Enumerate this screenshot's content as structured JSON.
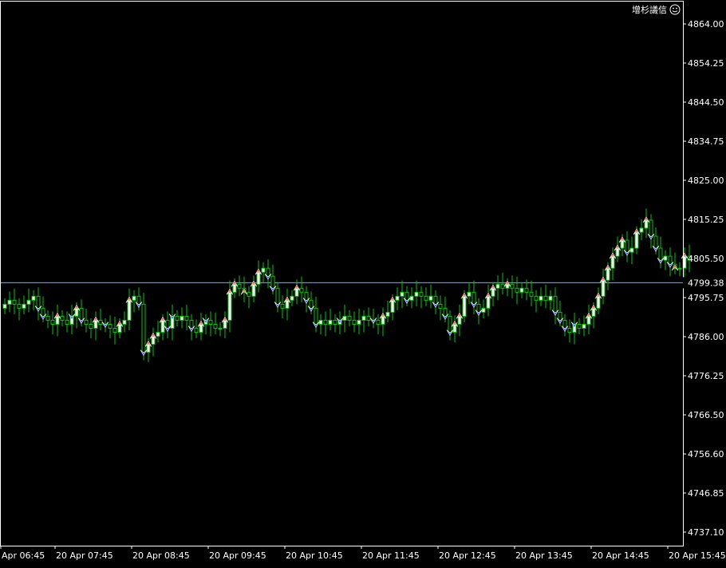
{
  "ea": {
    "name": "增杉議信",
    "smiley": "☺"
  },
  "colors": {
    "background": "#000000",
    "axis": "#ffffff",
    "bull": "#00c800",
    "bull_body": "#ffffff",
    "bear": "#00c800",
    "bear_body": "#000000",
    "price_line": "#8faac2",
    "buy_marker": "#1e3cff",
    "sell_marker": "#ff2020"
  },
  "current_price": "4799.38",
  "y_ticks": [
    "4864.00",
    "4854.25",
    "4844.50",
    "4834.75",
    "4825.00",
    "4815.25",
    "4805.50",
    "4795.75",
    "4786.00",
    "4776.25",
    "4766.50",
    "4756.60",
    "4746.85",
    "4737.10"
  ],
  "x_ticks": [
    "Apr 06:45",
    "20 Apr 07:45",
    "20 Apr 08:45",
    "20 Apr 09:45",
    "20 Apr 10:45",
    "20 Apr 11:45",
    "20 Apr 12:45",
    "20 Apr 13:45",
    "20 Apr 14:45",
    "20 Apr 15:45"
  ],
  "chart_data": {
    "type": "candlestick",
    "symbol_timeframe": "",
    "ylim": [
      4734.0,
      4868.0
    ],
    "last_price": 4799.38,
    "x_labels": [
      "Apr 06:45",
      "20 Apr 07:45",
      "20 Apr 08:45",
      "20 Apr 09:45",
      "20 Apr 10:45",
      "20 Apr 11:45",
      "20 Apr 12:45",
      "20 Apr 13:45",
      "20 Apr 14:45",
      "20 Apr 15:45"
    ],
    "closes": [
      4794,
      4795,
      4794,
      4793,
      4794,
      4795,
      4796,
      4793,
      4791,
      4790,
      4789,
      4791,
      4790,
      4789,
      4791,
      4793,
      4790,
      4789,
      4788,
      4790,
      4789,
      4789,
      4788,
      4787,
      4789,
      4790,
      4795,
      4796,
      4794,
      4782,
      4784,
      4786,
      4787,
      4790,
      4788,
      4791,
      4790,
      4791,
      4790,
      4788,
      4787,
      4789,
      4790,
      4789,
      4788,
      4788,
      4790,
      4797,
      4799,
      4798,
      4797,
      4796,
      4799,
      4802,
      4803,
      4801,
      4798,
      4794,
      4793,
      4795,
      4796,
      4798,
      4797,
      4795,
      4793,
      4789,
      4790,
      4789,
      4790,
      4789,
      4790,
      4791,
      4790,
      4789,
      4790,
      4791,
      4790,
      4790,
      4789,
      4791,
      4792,
      4795,
      4796,
      4797,
      4795,
      4796,
      4797,
      4796,
      4795,
      4796,
      4794,
      4793,
      4791,
      4787,
      4789,
      4791,
      4796,
      4797,
      4794,
      4792,
      4793,
      4796,
      4798,
      4799,
      4798,
      4799,
      4798,
      4797,
      4798,
      4797,
      4796,
      4795,
      4796,
      4795,
      4796,
      4792,
      4790,
      4788,
      4787,
      4789,
      4788,
      4789,
      4791,
      4793,
      4796,
      4800,
      4803,
      4806,
      4808,
      4810,
      4807,
      4808,
      4812,
      4813,
      4815,
      4811,
      4808,
      4805,
      4806,
      4804,
      4803,
      4803,
      4806,
      4805
    ]
  }
}
